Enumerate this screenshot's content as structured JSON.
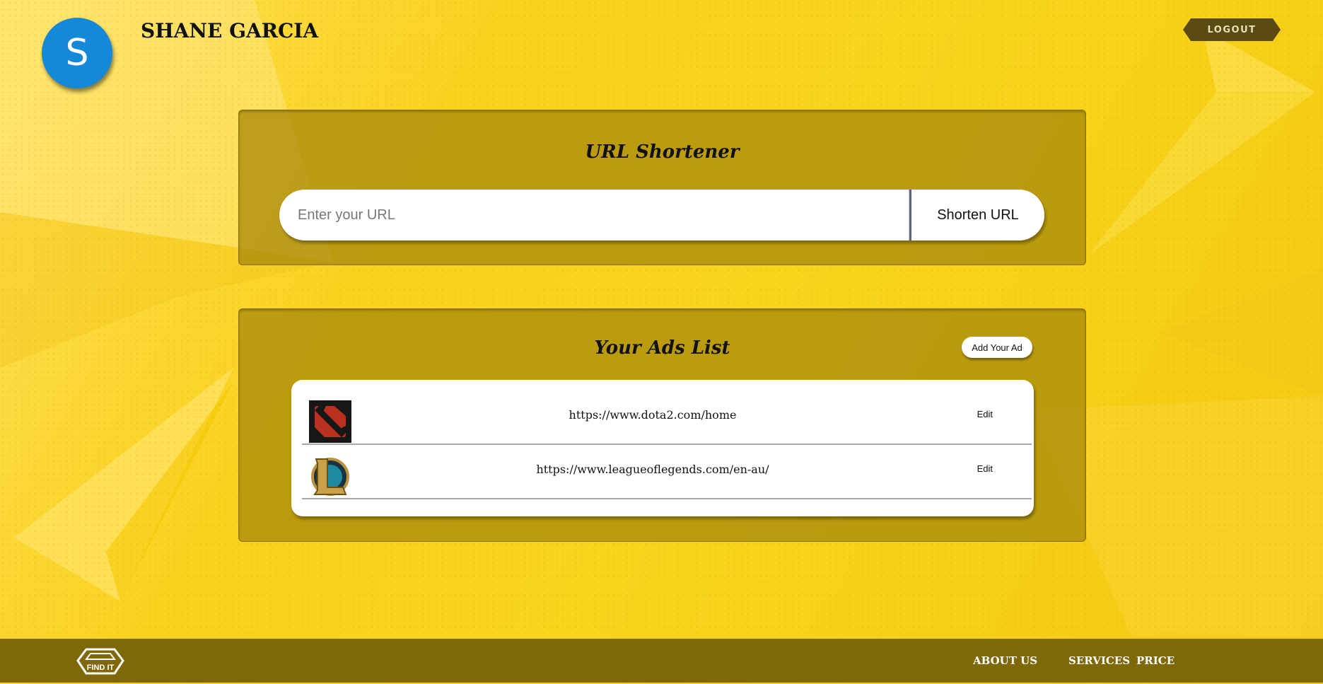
{
  "header": {
    "avatar_initial": "S",
    "user_name": "SHANE GARCIA",
    "logout_label": "LOGOUT"
  },
  "shortener": {
    "title": "URL Shortener",
    "input_placeholder": "Enter your URL",
    "button_label": "Shorten URL"
  },
  "ads": {
    "title": "Your Ads List",
    "add_button_label": "Add Your Ad",
    "items": [
      {
        "icon": "dota2-logo-icon",
        "url": "https://www.dota2.com/home",
        "edit_label": "Edit"
      },
      {
        "icon": "league-of-legends-logo-icon",
        "url": "https://www.leagueoflegends.com/en-au/",
        "edit_label": "Edit"
      }
    ]
  },
  "footer": {
    "logo_text": "FIND IT",
    "links": [
      "ABOUT US",
      "SERVICES",
      "PRICE"
    ]
  },
  "colors": {
    "background": "#f9d21f",
    "panel": "#aa8c0c",
    "footer": "#7f6808",
    "avatar": "#1588d8",
    "logout": "#5b4b12"
  }
}
